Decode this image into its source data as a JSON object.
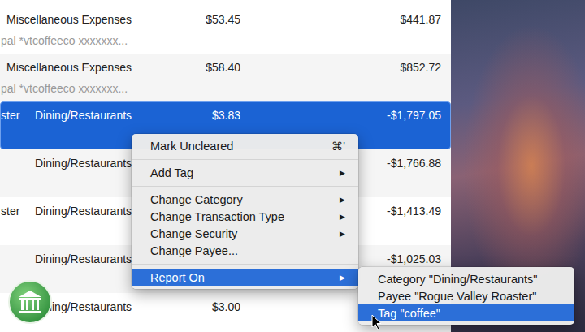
{
  "register": {
    "rows": [
      {
        "payee": "",
        "category": "Miscellaneous Expenses",
        "amount": "$53.45",
        "balance": "$441.87",
        "memo": "pal *vtcoffeeco xxxxxxx...",
        "selected": false
      },
      {
        "payee": "",
        "category": "Miscellaneous Expenses",
        "amount": "$58.40",
        "balance": "$852.72",
        "memo": "pal *vtcoffeeco xxxxxxx...",
        "selected": false
      },
      {
        "payee": "ster",
        "category": "Dining/Restaurants",
        "amount": "$3.83",
        "balance": "-$1,797.05",
        "memo": "",
        "selected": true
      },
      {
        "payee": "",
        "category": "Dining/Restaurants",
        "amount": "",
        "balance": "-$1,766.88",
        "memo": "",
        "selected": false
      },
      {
        "payee": "ster",
        "category": "Dining/Restaurants",
        "amount": "",
        "balance": "-$1,413.49",
        "memo": "",
        "selected": false
      },
      {
        "payee": "",
        "category": "Dining/Restaurants",
        "amount": "",
        "balance": "-$1,025.03",
        "memo": "",
        "selected": false
      },
      {
        "payee": "",
        "category": "Dining/Restaurants",
        "amount": "$3.00",
        "balance": "",
        "memo": "",
        "selected": false
      }
    ]
  },
  "context_menu": {
    "groups": [
      [
        {
          "label": "Mark Uncleared",
          "shortcut": "⌘'",
          "arrow": "",
          "selected": false
        }
      ],
      [
        {
          "label": "Add Tag",
          "shortcut": "",
          "arrow": "▶",
          "selected": false
        }
      ],
      [
        {
          "label": "Change Category",
          "shortcut": "",
          "arrow": "▶",
          "selected": false
        },
        {
          "label": "Change Transaction Type",
          "shortcut": "",
          "arrow": "▶",
          "selected": false
        },
        {
          "label": "Change Security",
          "shortcut": "",
          "arrow": "▶",
          "selected": false
        },
        {
          "label": "Change Payee...",
          "shortcut": "",
          "arrow": "",
          "selected": false
        }
      ],
      [
        {
          "label": "Report On",
          "shortcut": "",
          "arrow": "▶",
          "selected": true
        }
      ]
    ]
  },
  "submenu": {
    "items": [
      {
        "label": "Category \"Dining/Restaurants\"",
        "selected": false
      },
      {
        "label": "Payee \"Rogue Valley Roaster\"",
        "selected": false
      },
      {
        "label": "Tag \"coffee\"",
        "selected": true
      }
    ]
  }
}
